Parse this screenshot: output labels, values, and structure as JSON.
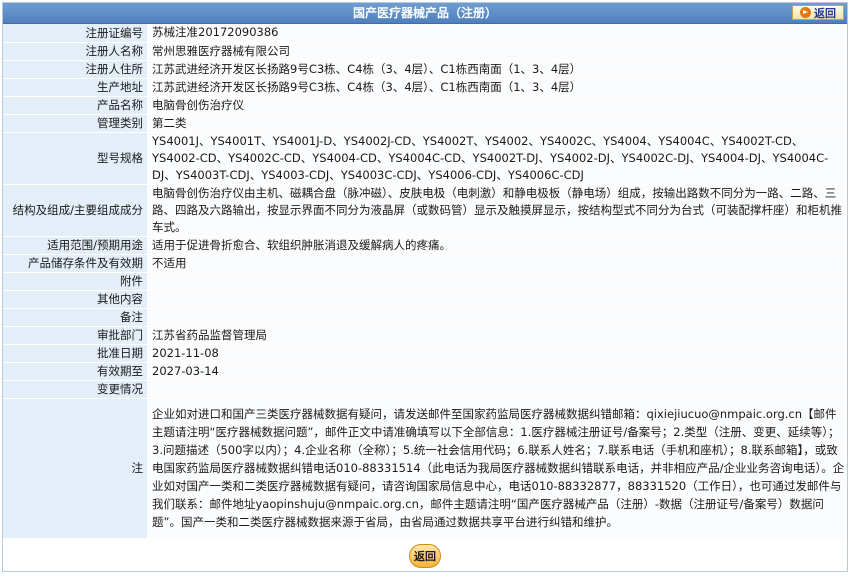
{
  "header": {
    "title": "国产医疗器械产品（注册）",
    "back_label": "返回"
  },
  "rows": [
    {
      "label": "注册证编号",
      "value": "苏械注准20172090386"
    },
    {
      "label": "注册人名称",
      "value": "常州思雅医疗器械有限公司"
    },
    {
      "label": "注册人住所",
      "value": "江苏武进经济开发区长扬路9号C3栋、C4栋（3、4层）、C1栋西南面（1、3、4层）"
    },
    {
      "label": "生产地址",
      "value": "江苏武进经济开发区长扬路9号C3栋、C4栋（3、4层）、C1栋西南面（1、3、4层）"
    },
    {
      "label": "产品名称",
      "value": "电脑骨创伤治疗仪"
    },
    {
      "label": "管理类别",
      "value": "第二类"
    },
    {
      "label": "型号规格",
      "value": "YS4001J、YS4001T、YS4001J-D、YS4002J-CD、YS4002T、YS4002、YS4002C、YS4004、YS4004C、YS4002T-CD、YS4002-CD、YS4002C-CD、YS4004-CD、YS4004C-CD、YS4002T-DJ、YS4002-DJ、YS4002C-DJ、YS4004-DJ、YS4004C-DJ、YS4003T-CDJ、YS4003-CDJ、YS4003C-CDJ、YS4006-CDJ、YS4006C-CDJ"
    },
    {
      "label": "结构及组成/主要组成成分",
      "value": "电脑骨创伤治疗仪由主机、磁耦合盘（脉冲磁）、皮肤电极（电刺激）和静电极板（静电场）组成，按输出路数不同分为一路、二路、三路、四路及六路输出，按显示界面不同分为液晶屏（或数码管）显示及触摸屏显示，按结构型式不同分为台式（可装配撑杆座）和柜机推车式。"
    },
    {
      "label": "适用范围/预期用途",
      "value": "适用于促进骨折愈合、软组织肿胀消退及缓解病人的疼痛。"
    },
    {
      "label": "产品储存条件及有效期",
      "value": "不适用"
    },
    {
      "label": "附件",
      "value": ""
    },
    {
      "label": "其他内容",
      "value": ""
    },
    {
      "label": "备注",
      "value": ""
    },
    {
      "label": "审批部门",
      "value": "江苏省药品监督管理局"
    },
    {
      "label": "批准日期",
      "value": "2021-11-08"
    },
    {
      "label": "有效期至",
      "value": "2027-03-14"
    },
    {
      "label": "变更情况",
      "value": ""
    }
  ],
  "note": {
    "label": "注",
    "text": "企业如对进口和国产三类医疗器械数据有疑问，请发送邮件至国家药监局医疗器械数据纠错邮箱：qixiejiucuo@nmpaic.org.cn【邮件主题请注明“医疗器械数据问题”，邮件正文中请准确填写以下全部信息：1.医疗器械注册证号/备案号；2.类型（注册、变更、延续等）；3.问题描述（500字以内）；4.企业名称（全称）；5.统一社会信用代码；6.联系人姓名；7.联系电话（手机和座机）；8.联系邮箱】，或致电国家药监局医疗器械数据纠错电话010-88331514（此电话为我局医疗器械数据纠错联系电话，并非相应产品/企业业务咨询电话）。企业如对国产一类和二类医疗器械数据有疑问，请咨询国家局信息中心，电话010-88332877，88331520（工作日），也可通过发邮件与我们联系：邮件地址yaopinshuju@nmpaic.org.cn，邮件主题请注明“国产医疗器械产品（注册）-数据（注册证号/备案号）数据问题”。国产一类和二类医疗器械数据来源于省局，由省局通过数据共享平台进行纠错和维护。"
  },
  "footer": {
    "back_label": "返回"
  }
}
